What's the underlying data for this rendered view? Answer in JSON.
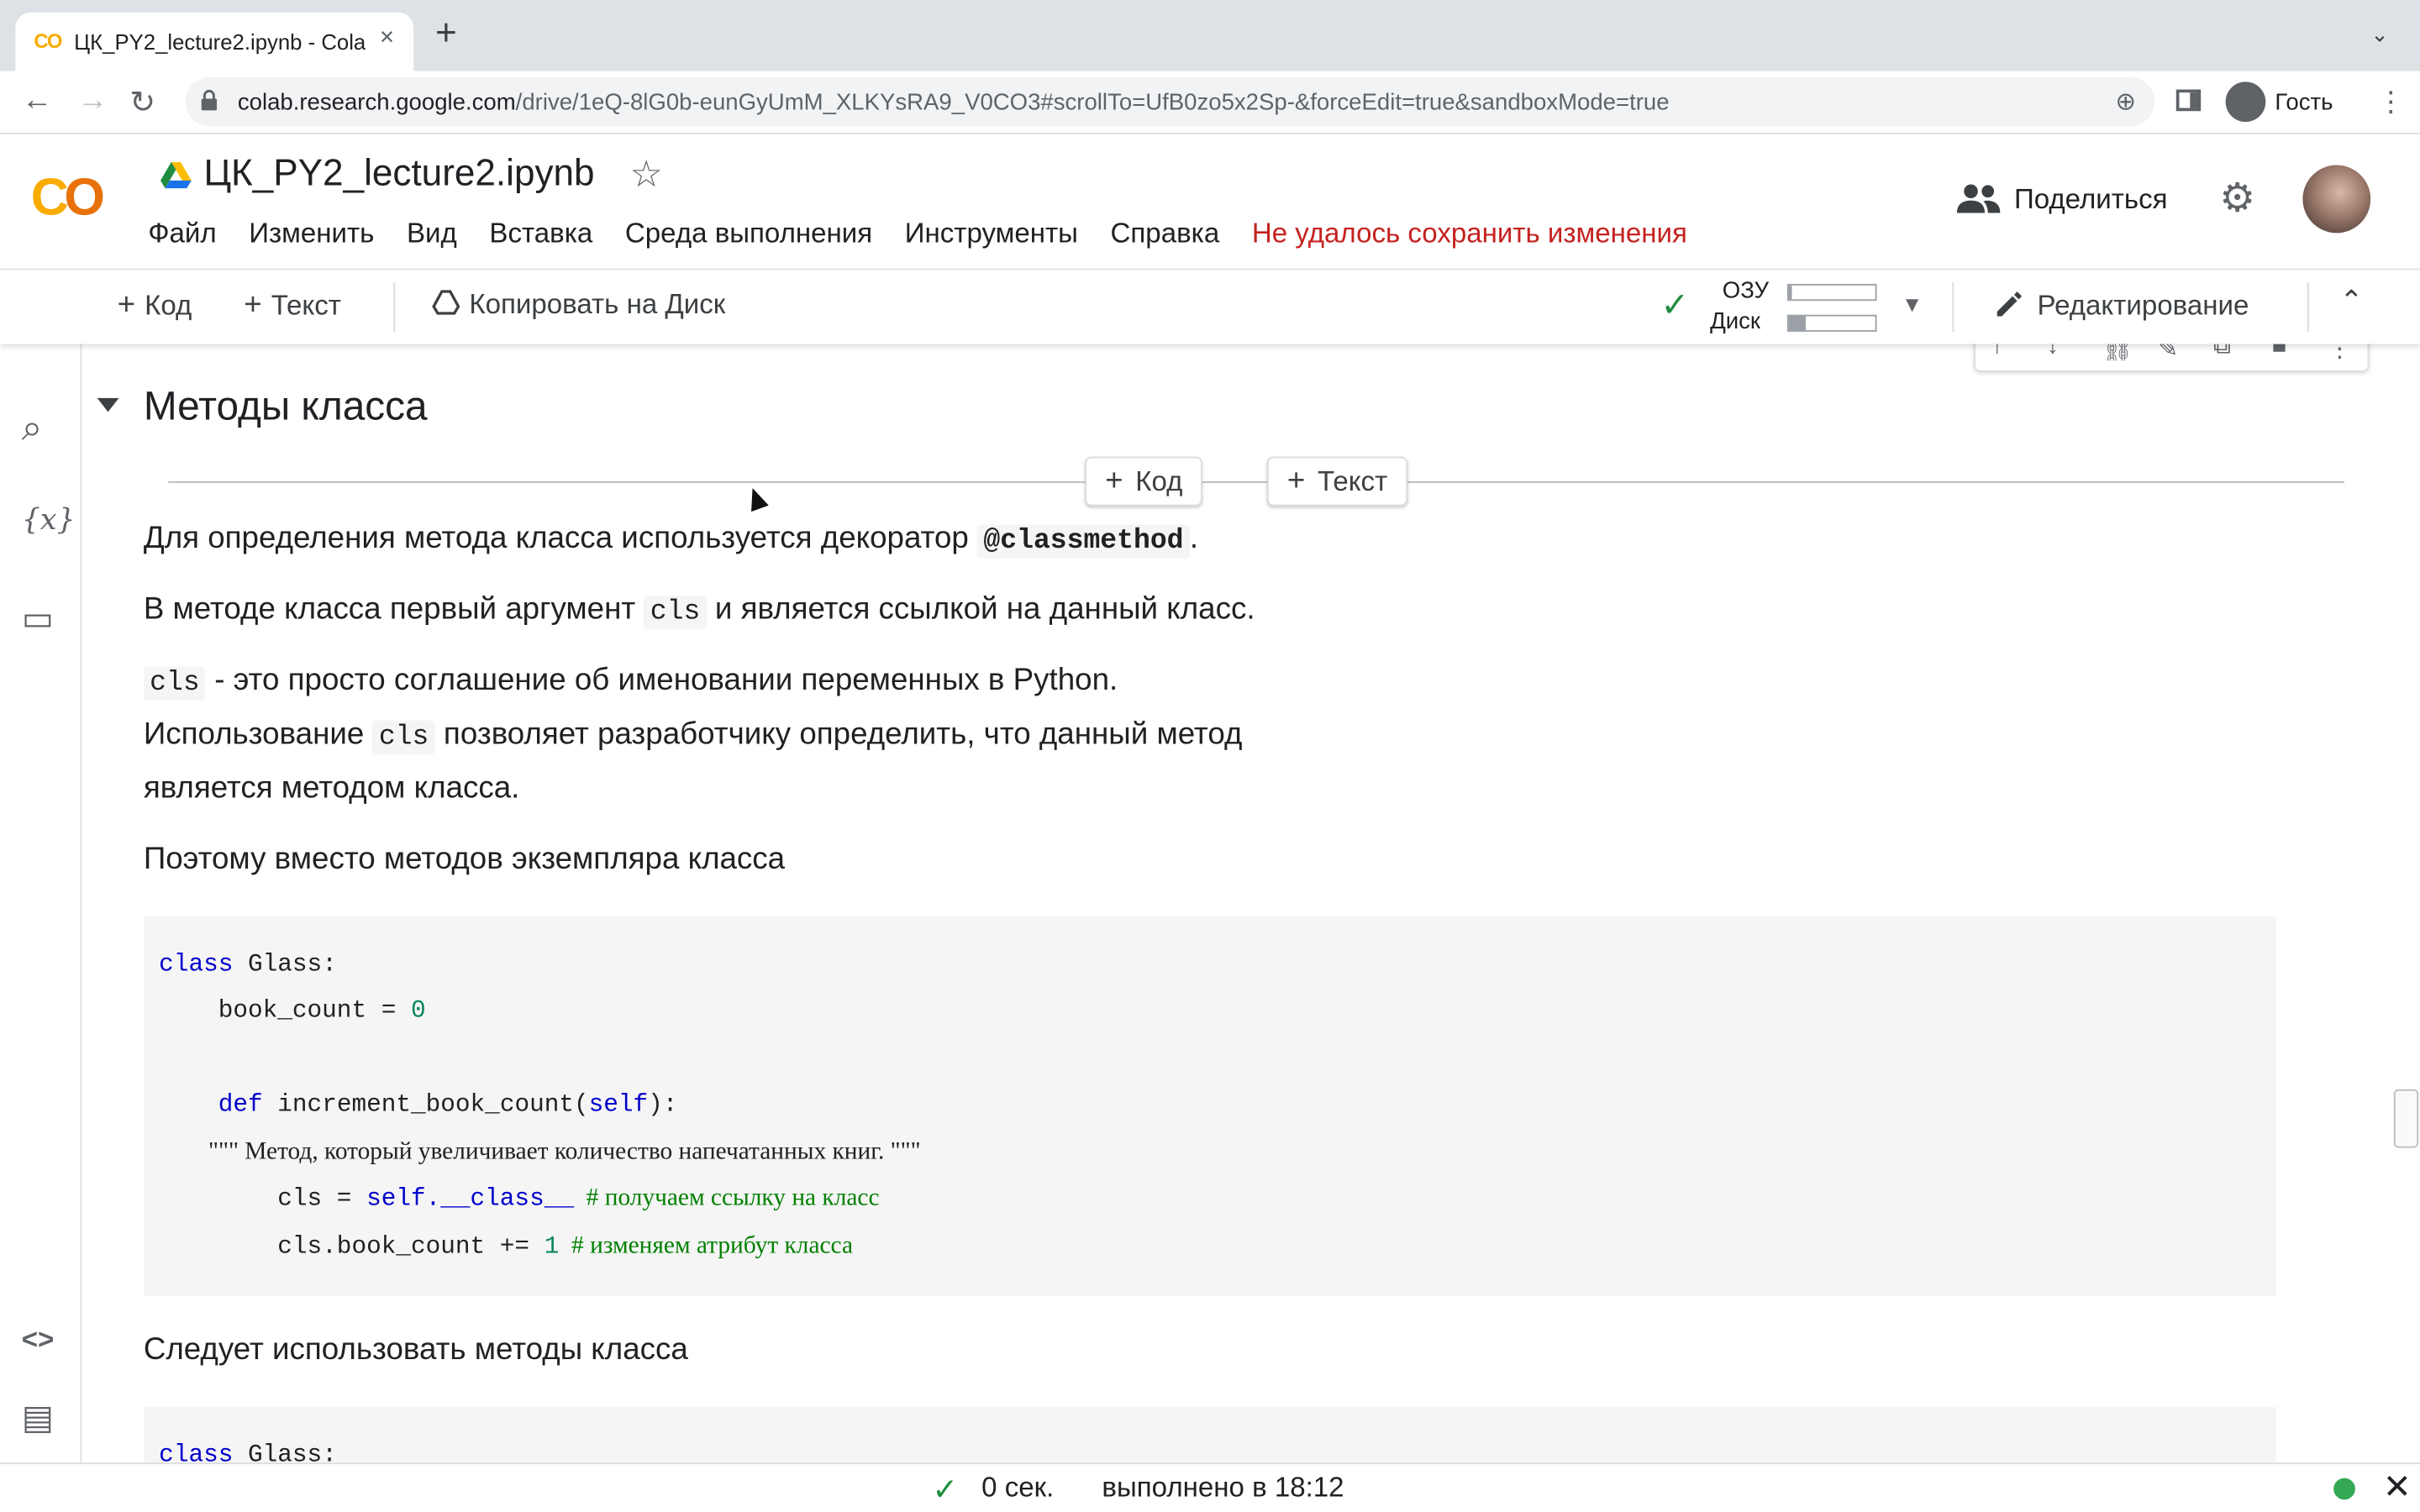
{
  "browser": {
    "tab_favicon": "CO",
    "tab_title": "ЦК_PY2_lecture2.ipynb - Cola",
    "tab_close": "×",
    "new_tab": "+",
    "tab_menu": "⌄",
    "url_host": "colab.research.google.com",
    "url_path": "/drive/1eQ-8lG0b-eunGyUmM_XLKYsRA9_V0CO3#scrollTo=UfB0zo5x2Sp-&forceEdit=true&sandboxMode=true",
    "guest_label": "Гость",
    "back": "←",
    "forward": "→",
    "reload": "↻",
    "zoom": "⊕",
    "menu": "⋮"
  },
  "colab": {
    "logo_left": "C",
    "logo_right": "O",
    "notebook_title": "ЦК_PY2_lecture2.ipynb",
    "star": "☆",
    "menu": {
      "file": "Файл",
      "edit": "Изменить",
      "view": "Вид",
      "insert": "Вставка",
      "runtime": "Среда выполнения",
      "tools": "Инструменты",
      "help": "Справка",
      "save_error": "Не удалось сохранить изменения"
    },
    "share_label": "Поделиться",
    "gear": "⚙"
  },
  "toolbar": {
    "plus": "+",
    "code_label": "Код",
    "text_label": "Текст",
    "copy_to_drive": "Копировать на Диск",
    "ram_label": "ОЗУ",
    "disk_label": "Диск",
    "ram_usage": 0.04,
    "disk_usage": 0.2,
    "check": "✓",
    "dropdown": "▼",
    "edit_mode": "Редактирование",
    "collapse": "⌃"
  },
  "rail": {
    "toc": "☰",
    "search": "⌕",
    "variables": "{x}",
    "files": "▭",
    "snippets": "<>",
    "terminal": "▤"
  },
  "cell_toolbar": {
    "up": "↑",
    "down": "↓",
    "link": "⛓",
    "edit": "✎",
    "mirror": "⧉",
    "delete": "■",
    "more": "⋮"
  },
  "notebook": {
    "section_title": "Методы класса",
    "add_code": "Код",
    "add_text": "Текст",
    "p1_before": "Для определения метода класса используется декоратор ",
    "p1_code": "@classmethod",
    "p1_after": ".",
    "p2_before": "В методе класса первый аргумент ",
    "p2_code": "cls",
    "p2_after": " и является ссылкой на данный класс.",
    "p3_code": "cls",
    "p3_after": " - это просто соглашение об именовании переменных в Python.",
    "p4_before": "Использование ",
    "p4_code": "cls",
    "p4_after": " позволяет разработчику определить, что данный метод",
    "p5": "является методом класса.",
    "p6": "Поэтому вместо методов экземпляра класса",
    "code1": {
      "l1_kw": "class",
      "l1_rest": " Glass:",
      "l2_name": "    book_count = ",
      "l2_num": "0",
      "l4_indent": "    ",
      "l4_kw": "def",
      "l4_name": " increment_book_count(",
      "l4_self": "self",
      "l4_end": "):",
      "l5": "        \"\"\" Метод, который увеличивает количество напечатанных книг. \"\"\"",
      "l6_a": "        cls = ",
      "l6_self": "self",
      "l6_attr": ".__class__",
      "l6_cmt": "  # получаем ссылку на класс",
      "l7_a": "        cls.book_count += ",
      "l7_num": "1",
      "l7_cmt": "  # изменяем атрибут класса"
    },
    "p7": "Следует использовать методы класса",
    "code2_l1_kw": "class",
    "code2_l1_rest": " Glass:"
  },
  "status": {
    "check": "✓",
    "duration": "0 сек.",
    "completed": "выполнено в 18:12",
    "close": "✕"
  }
}
